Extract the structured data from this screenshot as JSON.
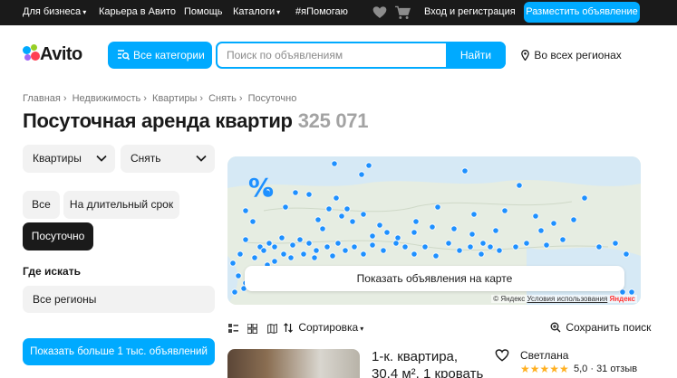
{
  "topbar": {
    "links": [
      "Для бизнеса",
      "Карьера в Авито",
      "Помощь",
      "Каталоги",
      "#яПомогаю"
    ],
    "login": "Вход и регистрация",
    "post_ad": "Разместить объявление"
  },
  "header": {
    "logo": "Avito",
    "categories_button": "Все категории",
    "search_placeholder": "Поиск по объявлениям",
    "search_button": "Найти",
    "region": "Во всех регионах"
  },
  "breadcrumb": [
    "Главная",
    "Недвижимость",
    "Квартиры",
    "Снять",
    "Посуточно"
  ],
  "page": {
    "title": "Посуточная аренда квартир",
    "count": "325 071"
  },
  "filters": {
    "type_select": "Квартиры",
    "deal_select": "Снять",
    "periods": [
      "Все",
      "На длительный срок",
      "Посуточно"
    ],
    "active_period": "Посуточно",
    "where_label": "Где искать",
    "regions_value": "Все регионы",
    "show_more": "Показать больше 1 тыс. объявлений"
  },
  "map": {
    "badge": "%",
    "show_button": "Показать объявления на карте",
    "attribution_copy": "© Яндекс",
    "attribution_terms": "Условия использования",
    "attribution_logo": "Яндекс"
  },
  "toolbar": {
    "sort": "Сортировка",
    "save_search": "Сохранить поиск"
  },
  "listing": {
    "title_line1": "1-к. квартира,",
    "title_line2": "30,4 м², 1 кровать",
    "seller": "Светлана",
    "stars": "★★★★★",
    "rating": "5,0 · 31 отзыв"
  },
  "colors": {
    "accent": "#00aaff",
    "dark": "#1a1a1a",
    "marker": "#1e90ff"
  }
}
